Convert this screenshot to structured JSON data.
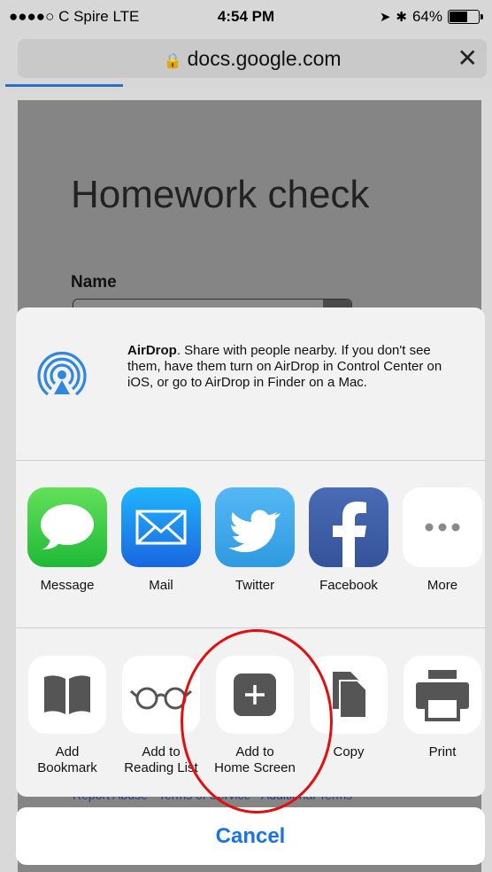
{
  "status_bar": {
    "carrier": "●●●●○ C Spire  LTE",
    "time": "4:54 PM",
    "battery": "64%",
    "battery_level": 0.64
  },
  "browser": {
    "url": "docs.google.com",
    "close_label": "✕"
  },
  "page": {
    "title": "Homework check",
    "name_label": "Name",
    "footer": "Report Abuse - Terms of Service - Additional Terms"
  },
  "share_sheet": {
    "airdrop": {
      "title": "AirDrop",
      "description": ". Share with people nearby. If you don't see them, have them turn on AirDrop in Control Center on iOS, or go to AirDrop in Finder on a Mac."
    },
    "apps": [
      {
        "label": "Message",
        "icon": "message-icon"
      },
      {
        "label": "Mail",
        "icon": "mail-icon"
      },
      {
        "label": "Twitter",
        "icon": "twitter-icon"
      },
      {
        "label": "Facebook",
        "icon": "facebook-icon"
      },
      {
        "label": "More",
        "icon": "more-icon"
      }
    ],
    "actions": [
      {
        "label": "Add\nBookmark",
        "icon": "book-icon"
      },
      {
        "label": "Add to\nReading List",
        "icon": "glasses-icon"
      },
      {
        "label": "Add to\nHome Screen",
        "icon": "plus-icon"
      },
      {
        "label": "Copy",
        "icon": "copy-icon"
      },
      {
        "label": "Print",
        "icon": "printer-icon"
      }
    ],
    "cancel": "Cancel"
  },
  "colors": {
    "accent": "#1a73e8",
    "highlight_circle": "#e01010"
  }
}
